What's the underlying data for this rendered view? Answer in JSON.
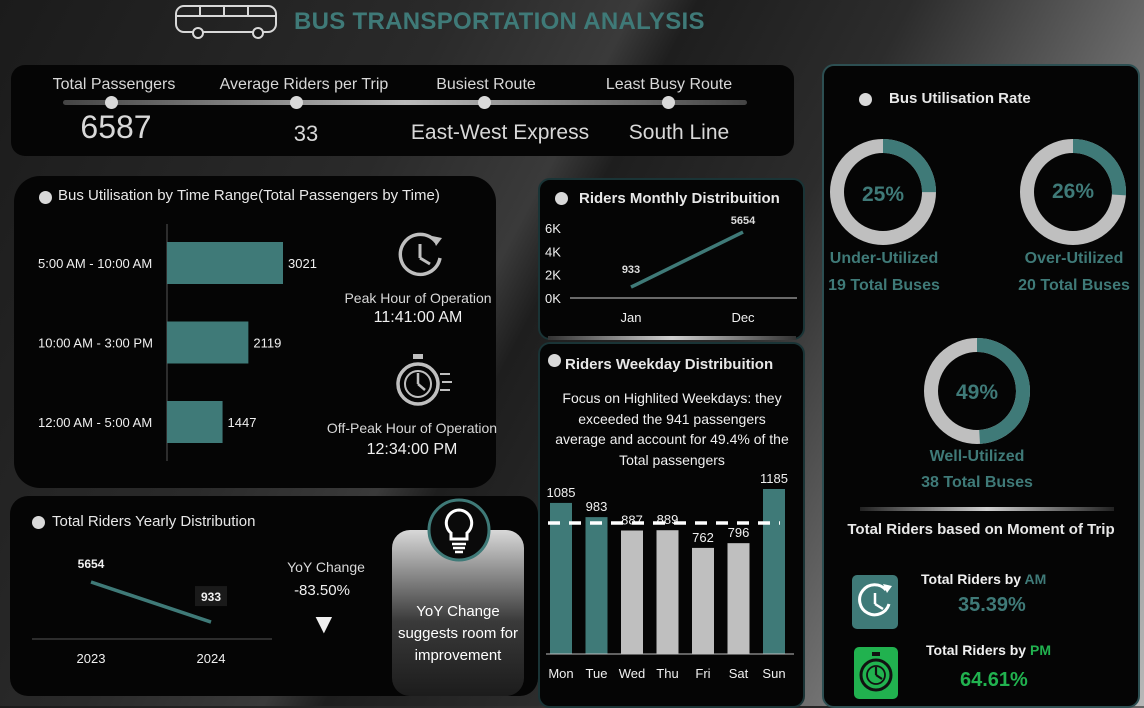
{
  "header": {
    "title": "BUS TRANSPORTATION ANALYSIS",
    "icon": "bus-icon"
  },
  "kpis": [
    {
      "label": "Total Passengers",
      "value": "6587"
    },
    {
      "label": "Average Riders per Trip",
      "value": "33"
    },
    {
      "label": "Busiest Route",
      "value": "East-West Express"
    },
    {
      "label": "Least Busy Route",
      "value": "South Line"
    }
  ],
  "time_range": {
    "title": "Bus Utilisation by Time Range(Total  Passengers by Time)",
    "peak_label": "Peak Hour of Operation",
    "peak_value": "11:41:00 AM",
    "offpeak_label": "Off-Peak Hour of Operation",
    "offpeak_value": "12:34:00 PM"
  },
  "monthly": {
    "title": "Riders Monthly Distribuition"
  },
  "weekday": {
    "title": "Riders Weekday Distribuition",
    "note": "Focus on Highlited Weekdays: they exceeded the 941 passengers average and account for 49.4% of the Total passengers"
  },
  "yearly": {
    "title": "Total  Riders Yearly Distribution",
    "yoy_label": "YoY Change",
    "yoy_value": "-83.50%",
    "arrow": "▼",
    "callout": "YoY Change suggests room for improvement"
  },
  "utilisation": {
    "title": "Bus  Utilisation Rate",
    "under": {
      "pct": "25%",
      "fraction": 0.25,
      "label": "Under-Utilized",
      "count": "19 Total Buses"
    },
    "over": {
      "pct": "26%",
      "fraction": 0.26,
      "label": "Over-Utilized",
      "count": "20 Total Buses"
    },
    "well": {
      "pct": "49%",
      "fraction": 0.49,
      "label": "Well-Utilized",
      "count": "38 Total Buses"
    },
    "moment_title": "Total Riders based on Moment of Trip",
    "am_label": "Total Riders by ",
    "am_suffix": "AM",
    "am_value": "35.39%",
    "pm_label": "Total Riders by ",
    "pm_suffix": "PM",
    "pm_value": "64.61%"
  },
  "colors": {
    "teal": "#3f7a78",
    "grey": "#bfbfbf",
    "green": "#21b24f",
    "panel": "#050505"
  },
  "chart_data": [
    {
      "type": "bar",
      "orientation": "horizontal",
      "categories": [
        "5:00 AM - 10:00 AM",
        "10:00 AM - 3:00 PM",
        "12:00 AM - 5:00 AM"
      ],
      "values": [
        3021,
        2119,
        1447
      ],
      "title": "Bus Utilisation by Time Range(Total  Passengers by Time)"
    },
    {
      "type": "line",
      "x": [
        "Jan",
        "Dec"
      ],
      "values": [
        933,
        5654
      ],
      "yticks": [
        "0K",
        "2K",
        "4K",
        "6K"
      ],
      "ylim": [
        0,
        6000
      ],
      "title": "Riders Monthly Distribuition"
    },
    {
      "type": "bar",
      "categories": [
        "Mon",
        "Tue",
        "Wed",
        "Thu",
        "Fri",
        "Sat",
        "Sun"
      ],
      "values": [
        1085,
        983,
        887,
        889,
        762,
        796,
        1185
      ],
      "highlighted": [
        true,
        true,
        false,
        false,
        false,
        false,
        true
      ],
      "average": 941,
      "title": "Riders Weekday Distribuition"
    },
    {
      "type": "line",
      "x": [
        "2023",
        "2024"
      ],
      "values": [
        5654,
        933
      ],
      "title": "Total  Riders Yearly Distribution"
    }
  ]
}
